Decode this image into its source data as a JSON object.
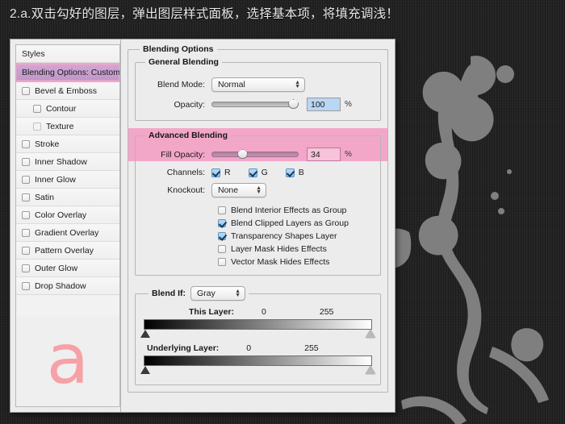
{
  "caption": "2.a.双击勾好的图层，弹出图层样式面板，选择基本项，将填充调浅！",
  "colors": {
    "backdrop": "#232323",
    "splatter": "#808080",
    "highlight_pink": "#f3a7c8",
    "selected_purple": "#c196c9",
    "preview_glyph": "#f79ba0",
    "dialog_bg": "#ececec"
  },
  "dialog": {
    "styles_pane": {
      "header": "Styles",
      "selected": "Blending Options: Custom",
      "items": [
        {
          "label": "Bevel & Emboss",
          "checked": false,
          "indent": false,
          "dim": false
        },
        {
          "label": "Contour",
          "checked": false,
          "indent": true,
          "dim": false
        },
        {
          "label": "Texture",
          "checked": false,
          "indent": true,
          "dim": true
        },
        {
          "label": "Stroke",
          "checked": false,
          "indent": false,
          "dim": false
        },
        {
          "label": "Inner Shadow",
          "checked": false,
          "indent": false,
          "dim": false
        },
        {
          "label": "Inner Glow",
          "checked": false,
          "indent": false,
          "dim": false
        },
        {
          "label": "Satin",
          "checked": false,
          "indent": false,
          "dim": false
        },
        {
          "label": "Color Overlay",
          "checked": false,
          "indent": false,
          "dim": false
        },
        {
          "label": "Gradient Overlay",
          "checked": false,
          "indent": false,
          "dim": false
        },
        {
          "label": "Pattern Overlay",
          "checked": false,
          "indent": false,
          "dim": false
        },
        {
          "label": "Outer Glow",
          "checked": false,
          "indent": false,
          "dim": false
        },
        {
          "label": "Drop Shadow",
          "checked": false,
          "indent": false,
          "dim": false
        }
      ],
      "preview_glyph": "a"
    },
    "blending_options": {
      "legend": "Blending Options",
      "general": {
        "legend": "General Blending",
        "blend_mode_label": "Blend Mode:",
        "blend_mode_value": "Normal",
        "opacity_label": "Opacity:",
        "opacity_value": "100",
        "opacity_percent": 100,
        "percent_sign": "%"
      },
      "advanced": {
        "legend": "Advanced Blending",
        "fill_opacity_label": "Fill Opacity:",
        "fill_opacity_value": "34",
        "fill_opacity_percent": 34,
        "percent_sign": "%",
        "channels_label": "Channels:",
        "channels": [
          {
            "label": "R",
            "checked": true
          },
          {
            "label": "G",
            "checked": true
          },
          {
            "label": "B",
            "checked": true
          }
        ],
        "knockout_label": "Knockout:",
        "knockout_value": "None",
        "options": [
          {
            "label": "Blend Interior Effects as Group",
            "checked": false
          },
          {
            "label": "Blend Clipped Layers as Group",
            "checked": true
          },
          {
            "label": "Transparency Shapes Layer",
            "checked": true
          },
          {
            "label": "Layer Mask Hides Effects",
            "checked": false
          },
          {
            "label": "Vector Mask Hides Effects",
            "checked": false
          }
        ]
      },
      "blend_if": {
        "legend": "Blend If:",
        "channel_value": "Gray",
        "this_layer": {
          "label": "This Layer:",
          "min": "0",
          "max": "255"
        },
        "underlying_layer": {
          "label": "Underlying Layer:",
          "min": "0",
          "max": "255"
        }
      }
    }
  }
}
